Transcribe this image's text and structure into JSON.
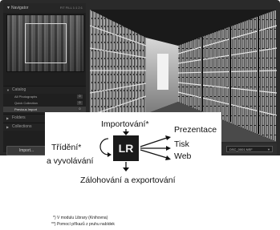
{
  "navigator": {
    "title": "Navigator",
    "options": "FIT FILL 1:1 2:1"
  },
  "catalog": {
    "title": "Catalog",
    "items": [
      {
        "label": "All Photographs",
        "count": "0"
      },
      {
        "label": "Quick Collection",
        "count": "0"
      },
      {
        "label": "Previous Import",
        "count": "0"
      }
    ]
  },
  "folders": {
    "title": "Folders"
  },
  "collections": {
    "title": "Collections"
  },
  "import_button": "Import...",
  "filename": "DSC_0001.NEF",
  "diagram": {
    "center": "LR",
    "top": "Importování*",
    "left_line1": "Třídění*",
    "left_line2": "a vyvolávání",
    "right": [
      "Prezentace",
      "Tisk",
      "Web"
    ],
    "bottom": "Zálohování a exportování",
    "footnotes": [
      "*) V modulu Library (Knihovna)",
      "**) Pomocí příkazů z pruhu nabídek"
    ]
  }
}
